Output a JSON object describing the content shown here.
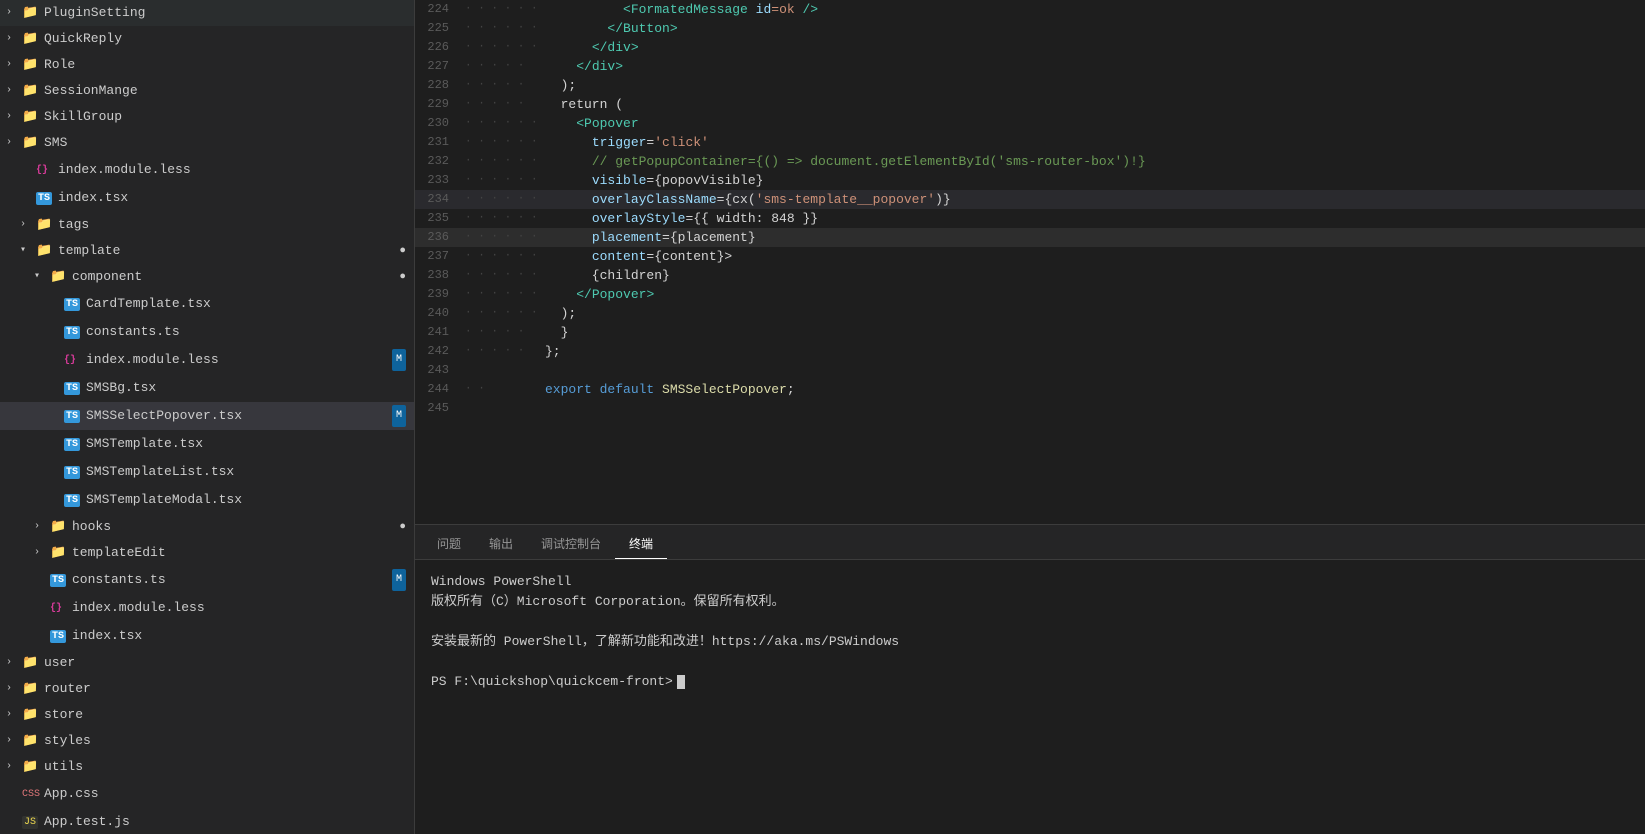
{
  "sidebar": {
    "items": [
      {
        "id": "plugin-setting",
        "label": "PluginSetting",
        "type": "folder",
        "indent": 0,
        "arrow": "›"
      },
      {
        "id": "quick-reply",
        "label": "QuickReply",
        "type": "folder",
        "indent": 0,
        "arrow": "›"
      },
      {
        "id": "role",
        "label": "Role",
        "type": "folder",
        "indent": 0,
        "arrow": "›"
      },
      {
        "id": "session-mange",
        "label": "SessionMange",
        "type": "folder",
        "indent": 0,
        "arrow": "›"
      },
      {
        "id": "skill-group",
        "label": "SkillGroup",
        "type": "folder",
        "indent": 0,
        "arrow": "›"
      },
      {
        "id": "sms",
        "label": "SMS",
        "type": "folder",
        "indent": 0,
        "arrow": "›"
      },
      {
        "id": "index-module-less",
        "label": "index.module.less",
        "type": "less",
        "indent": 1
      },
      {
        "id": "index-tsx",
        "label": "index.tsx",
        "type": "ts",
        "indent": 1
      },
      {
        "id": "tags",
        "label": "tags",
        "type": "folder-open",
        "indent": 1,
        "arrow": "›"
      },
      {
        "id": "template",
        "label": "template",
        "type": "folder-open",
        "indent": 1,
        "arrow": "∨",
        "badge": "●"
      },
      {
        "id": "component",
        "label": "component",
        "type": "folder-open",
        "indent": 2,
        "arrow": "∨",
        "badge": "●"
      },
      {
        "id": "card-template-tsx",
        "label": "CardTemplate.tsx",
        "type": "ts",
        "indent": 3
      },
      {
        "id": "constants-ts",
        "label": "constants.ts",
        "type": "ts",
        "indent": 3
      },
      {
        "id": "index-module-less-2",
        "label": "index.module.less",
        "type": "less",
        "indent": 3,
        "badge": "M"
      },
      {
        "id": "sms-bg-tsx",
        "label": "SMSBg.tsx",
        "type": "ts",
        "indent": 3
      },
      {
        "id": "sms-select-popover-tsx",
        "label": "SMSSelectPopover.tsx",
        "type": "ts",
        "indent": 3,
        "badge": "M",
        "active": true
      },
      {
        "id": "sms-template-tsx",
        "label": "SMSTemplate.tsx",
        "type": "ts",
        "indent": 3
      },
      {
        "id": "sms-template-list-tsx",
        "label": "SMSTemplateList.tsx",
        "type": "ts",
        "indent": 3
      },
      {
        "id": "sms-template-modal-tsx",
        "label": "SMSTemplateModal.tsx",
        "type": "ts",
        "indent": 3
      },
      {
        "id": "hooks",
        "label": "hooks",
        "type": "folder-open",
        "indent": 2,
        "arrow": "›",
        "badge": "●"
      },
      {
        "id": "template-edit",
        "label": "templateEdit",
        "type": "folder",
        "indent": 2,
        "arrow": "›"
      },
      {
        "id": "constants-ts-2",
        "label": "constants.ts",
        "type": "ts",
        "indent": 2,
        "badge": "M"
      },
      {
        "id": "index-module-less-3",
        "label": "index.module.less",
        "type": "less",
        "indent": 2
      },
      {
        "id": "index-tsx-2",
        "label": "index.tsx",
        "type": "ts",
        "indent": 2
      },
      {
        "id": "user",
        "label": "user",
        "type": "folder",
        "indent": 0,
        "arrow": "›"
      },
      {
        "id": "router",
        "label": "router",
        "type": "folder",
        "indent": 0,
        "arrow": "›"
      },
      {
        "id": "store",
        "label": "store",
        "type": "folder",
        "indent": 0,
        "arrow": "›"
      },
      {
        "id": "styles",
        "label": "styles",
        "type": "folder",
        "indent": 0,
        "arrow": "›"
      },
      {
        "id": "utils",
        "label": "utils",
        "type": "folder",
        "indent": 0,
        "arrow": "›"
      },
      {
        "id": "app-css",
        "label": "App.css",
        "type": "css",
        "indent": 0
      },
      {
        "id": "app-test-js",
        "label": "App.test.js",
        "type": "js",
        "indent": 0
      }
    ]
  },
  "editor": {
    "lines": [
      {
        "num": 224,
        "dots": "· · · · · ·",
        "content": [
          {
            "t": "          ",
            "c": ""
          },
          {
            "t": "<",
            "c": "c-tag"
          },
          {
            "t": "FormatedMessage",
            "c": "c-tag"
          },
          {
            "t": " id",
            "c": "c-attr"
          },
          {
            "t": "=ok",
            "c": "c-string"
          },
          {
            "t": " />",
            "c": "c-tag"
          }
        ]
      },
      {
        "num": 225,
        "dots": "· · · · · ·",
        "content": [
          {
            "t": "        ",
            "c": ""
          },
          {
            "t": "</",
            "c": "c-tag"
          },
          {
            "t": "Button",
            "c": "c-tag"
          },
          {
            "t": ">",
            "c": "c-tag"
          }
        ]
      },
      {
        "num": 226,
        "dots": "· · · · · ·",
        "content": [
          {
            "t": "      ",
            "c": ""
          },
          {
            "t": "</",
            "c": "c-tag"
          },
          {
            "t": "div",
            "c": "c-tag"
          },
          {
            "t": ">",
            "c": "c-tag"
          }
        ]
      },
      {
        "num": 227,
        "dots": "· · · · ·",
        "content": [
          {
            "t": "    ",
            "c": ""
          },
          {
            "t": "</",
            "c": "c-tag"
          },
          {
            "t": "div",
            "c": "c-tag"
          },
          {
            "t": ">",
            "c": "c-tag"
          }
        ]
      },
      {
        "num": 228,
        "dots": "· · · · ·",
        "content": [
          {
            "t": "  );",
            "c": "c-default"
          }
        ]
      },
      {
        "num": 229,
        "dots": "· · · · ·",
        "content": [
          {
            "t": "  return (",
            "c": "c-default"
          }
        ]
      },
      {
        "num": 230,
        "dots": "· · · · · ·",
        "content": [
          {
            "t": "    ",
            "c": ""
          },
          {
            "t": "<",
            "c": "c-tag"
          },
          {
            "t": "Popover",
            "c": "c-tag"
          }
        ]
      },
      {
        "num": 231,
        "dots": "· · · · · ·",
        "content": [
          {
            "t": "      ",
            "c": ""
          },
          {
            "t": "trigger",
            "c": "c-attr"
          },
          {
            "t": "=",
            "c": "c-default"
          },
          {
            "t": "'click'",
            "c": "c-string"
          }
        ]
      },
      {
        "num": 232,
        "dots": "· · · · · ·",
        "content": [
          {
            "t": "      ",
            "c": ""
          },
          {
            "t": "// getPopupContainer={() => document.getElementById('sms-router-box')!}",
            "c": "c-comment"
          }
        ]
      },
      {
        "num": 233,
        "dots": "· · · · · ·",
        "content": [
          {
            "t": "      ",
            "c": ""
          },
          {
            "t": "visible",
            "c": "c-attr"
          },
          {
            "t": "={popovVisible}",
            "c": "c-default"
          }
        ]
      },
      {
        "num": 234,
        "dots": "· · · · · ·",
        "content": [
          {
            "t": "      ",
            "c": ""
          },
          {
            "t": "overlayClassName",
            "c": "c-attr"
          },
          {
            "t": "={cx(",
            "c": "c-default"
          },
          {
            "t": "'sms-template__popover'",
            "c": "c-string"
          },
          {
            "t": ")}",
            "c": "c-default"
          }
        ],
        "highlight": true
      },
      {
        "num": 235,
        "dots": "· · · · · ·",
        "content": [
          {
            "t": "      ",
            "c": ""
          },
          {
            "t": "overlayStyle",
            "c": "c-attr"
          },
          {
            "t": "={{ width: 848 }}",
            "c": "c-default"
          }
        ]
      },
      {
        "num": 236,
        "dots": "· · · · · ·",
        "content": [
          {
            "t": "      ",
            "c": ""
          },
          {
            "t": "placement",
            "c": "c-attr"
          },
          {
            "t": "={placement}",
            "c": "c-default"
          }
        ]
      },
      {
        "num": 237,
        "dots": "· · · · · ·",
        "content": [
          {
            "t": "      ",
            "c": ""
          },
          {
            "t": "content",
            "c": "c-attr"
          },
          {
            "t": "={content}>",
            "c": "c-default"
          }
        ]
      },
      {
        "num": 238,
        "dots": "· · · · · ·",
        "content": [
          {
            "t": "      {children}",
            "c": "c-default"
          }
        ]
      },
      {
        "num": 239,
        "dots": "· · · · · ·",
        "content": [
          {
            "t": "    ",
            "c": ""
          },
          {
            "t": "</",
            "c": "c-tag"
          },
          {
            "t": "Popover",
            "c": "c-tag"
          },
          {
            "t": ">",
            "c": "c-tag"
          }
        ]
      },
      {
        "num": 240,
        "dots": "· · · · · ·",
        "content": [
          {
            "t": "  );",
            "c": "c-default"
          }
        ]
      },
      {
        "num": 241,
        "dots": "· · · · ·",
        "content": [
          {
            "t": "  }",
            "c": "c-default"
          }
        ]
      },
      {
        "num": 242,
        "dots": "· · · · ·",
        "content": [
          {
            "t": "};",
            "c": "c-default"
          }
        ]
      },
      {
        "num": 243,
        "dots": "",
        "content": []
      },
      {
        "num": 244,
        "dots": "· ·",
        "content": [
          {
            "t": "export",
            "c": "c-export"
          },
          {
            "t": " default ",
            "c": "c-keyword"
          },
          {
            "t": "SMSSelectPopover",
            "c": "c-yellow"
          },
          {
            "t": ";",
            "c": "c-default"
          }
        ]
      },
      {
        "num": 245,
        "dots": "",
        "content": []
      }
    ]
  },
  "terminal": {
    "tabs": [
      {
        "id": "problems",
        "label": "问题"
      },
      {
        "id": "output",
        "label": "输出"
      },
      {
        "id": "debug-console",
        "label": "调试控制台"
      },
      {
        "id": "terminal",
        "label": "终端",
        "active": true
      }
    ],
    "lines": [
      {
        "text": "Windows PowerShell"
      },
      {
        "text": "版权所有（C）Microsoft Corporation。保留所有权利。"
      },
      {
        "text": ""
      },
      {
        "text": "安装最新的 PowerShell，了解新功能和改进！https://aka.ms/PSWindows"
      },
      {
        "text": ""
      }
    ],
    "prompt": "PS F:\\quickshop\\quickcem-front> "
  }
}
